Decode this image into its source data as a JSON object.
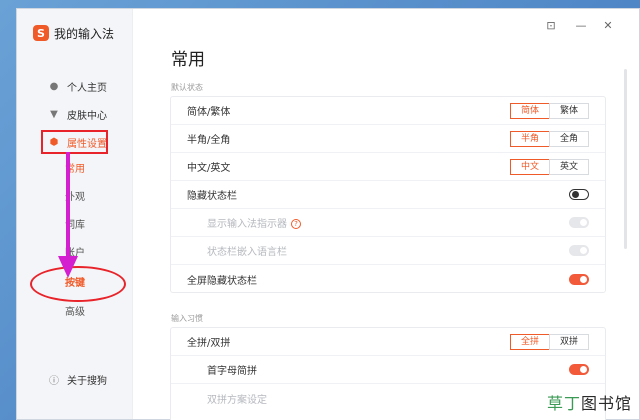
{
  "app": {
    "name": "我的输入法",
    "logo_text": "S"
  },
  "titlebar": {
    "icons": [
      "feedback-icon",
      "minimize-icon",
      "close-icon"
    ]
  },
  "sidebar": {
    "items": [
      {
        "label": "个人主页",
        "icon": "person-icon"
      },
      {
        "label": "皮肤中心",
        "icon": "shirt-icon"
      },
      {
        "label": "属性设置",
        "icon": "gear-icon",
        "active": true
      }
    ],
    "subitems": [
      "常用",
      "外观",
      "词库",
      "账户",
      "按键",
      "高级"
    ],
    "about": {
      "label": "关于搜狗",
      "icon": "info-icon"
    }
  },
  "main": {
    "title": "常用",
    "section1": {
      "label": "默认状态",
      "rows": [
        {
          "label": "简体/繁体",
          "options": [
            "简体",
            "繁体"
          ],
          "selected": 0
        },
        {
          "label": "半角/全角",
          "options": [
            "半角",
            "全角"
          ],
          "selected": 0
        },
        {
          "label": "中文/英文",
          "options": [
            "中文",
            "英文"
          ],
          "selected": 0
        },
        {
          "label": "隐藏状态栏",
          "toggle": "off"
        },
        {
          "label": "显示输入法指示器",
          "toggle": "disabled"
        },
        {
          "label": "状态栏嵌入语言栏",
          "toggle": "disabled"
        },
        {
          "label": "全屏隐藏状态栏",
          "toggle": "on"
        }
      ]
    },
    "section2": {
      "label": "输入习惯",
      "rows": [
        {
          "label": "全拼/双拼",
          "options": [
            "全拼",
            "双拼"
          ],
          "selected": 0
        },
        {
          "label": "首字母简拼",
          "toggle": "on"
        },
        {
          "label": "双拼方案设定"
        }
      ]
    }
  },
  "watermark": {
    "part1": "草丁",
    "part2": "图书馆"
  },
  "colors": {
    "accent": "#f05a28",
    "annotation": "#e8232a",
    "arrow": "#d41fd1"
  }
}
